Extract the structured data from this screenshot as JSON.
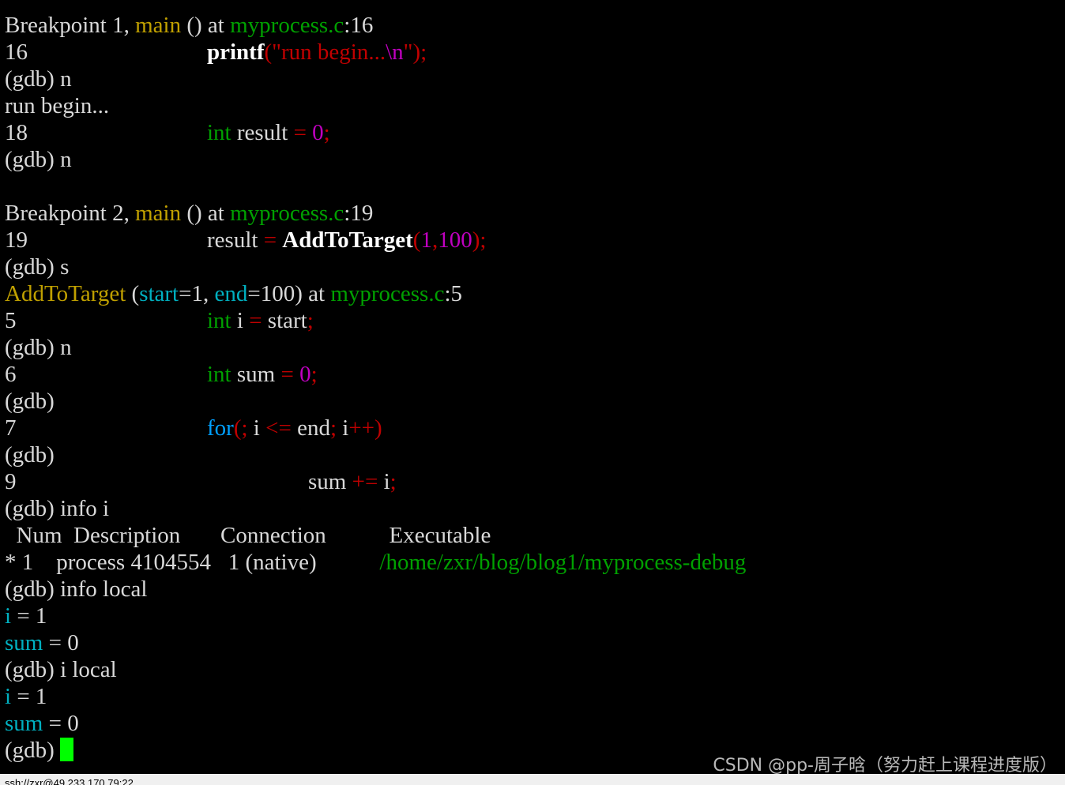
{
  "colors": {
    "background": "#000000",
    "text": "#d9d9d9",
    "function": "#c0a000",
    "filename": "#00a000",
    "string": "#c00000",
    "number": "#c000c0",
    "type": "#00a000",
    "keyword": "#00a0ff",
    "operator": "#c00000",
    "variable": "#00b0c0",
    "cursor": "#00ff00"
  },
  "terminal": {
    "lines": [
      [
        [
          "Breakpoint 1, ",
          "text"
        ],
        [
          "main",
          "function"
        ],
        [
          " () at ",
          "text"
        ],
        [
          "myprocess.c",
          "filename"
        ],
        [
          ":16",
          "text"
        ]
      ],
      [
        [
          "16",
          "text"
        ],
        [
          null,
          "tab1"
        ],
        [
          "printf",
          "bold"
        ],
        [
          "(",
          "operator"
        ],
        [
          "\"run begin...",
          "string"
        ],
        [
          "\\n",
          "number"
        ],
        [
          "\"",
          "string"
        ],
        [
          ");",
          "operator"
        ]
      ],
      [
        [
          "(gdb) n",
          "text"
        ]
      ],
      [
        [
          "run begin...",
          "text"
        ]
      ],
      [
        [
          "18",
          "text"
        ],
        [
          null,
          "tab1"
        ],
        [
          "int",
          "type"
        ],
        [
          " result ",
          "text"
        ],
        [
          "=",
          "operator"
        ],
        [
          " ",
          "text"
        ],
        [
          "0",
          "number"
        ],
        [
          ";",
          "operator"
        ]
      ],
      [
        [
          "(gdb) n",
          "text"
        ]
      ],
      [],
      [
        [
          "Breakpoint 2, ",
          "text"
        ],
        [
          "main",
          "function"
        ],
        [
          " () at ",
          "text"
        ],
        [
          "myprocess.c",
          "filename"
        ],
        [
          ":19",
          "text"
        ]
      ],
      [
        [
          "19",
          "text"
        ],
        [
          null,
          "tab1"
        ],
        [
          "result ",
          "text"
        ],
        [
          "=",
          "operator"
        ],
        [
          " ",
          "text"
        ],
        [
          "AddToTarget",
          "bold"
        ],
        [
          "(",
          "operator"
        ],
        [
          "1",
          "number"
        ],
        [
          ",",
          "operator"
        ],
        [
          "100",
          "number"
        ],
        [
          ");",
          "operator"
        ]
      ],
      [
        [
          "(gdb) s",
          "text"
        ]
      ],
      [
        [
          "AddToTarget",
          "function"
        ],
        [
          " (",
          "text"
        ],
        [
          "start",
          "variable"
        ],
        [
          "=1, ",
          "text"
        ],
        [
          "end",
          "variable"
        ],
        [
          "=100) at ",
          "text"
        ],
        [
          "myprocess.c",
          "filename"
        ],
        [
          ":5",
          "text"
        ]
      ],
      [
        [
          "5",
          "text"
        ],
        [
          null,
          "tab1"
        ],
        [
          "int",
          "type"
        ],
        [
          " i ",
          "text"
        ],
        [
          "=",
          "operator"
        ],
        [
          " start",
          "text"
        ],
        [
          ";",
          "operator"
        ]
      ],
      [
        [
          "(gdb) n",
          "text"
        ]
      ],
      [
        [
          "6",
          "text"
        ],
        [
          null,
          "tab1"
        ],
        [
          "int",
          "type"
        ],
        [
          " sum ",
          "text"
        ],
        [
          "=",
          "operator"
        ],
        [
          " ",
          "text"
        ],
        [
          "0",
          "number"
        ],
        [
          ";",
          "operator"
        ]
      ],
      [
        [
          "(gdb)",
          "text"
        ]
      ],
      [
        [
          "7",
          "text"
        ],
        [
          null,
          "tab1"
        ],
        [
          "for",
          "keyword"
        ],
        [
          "(;",
          "operator"
        ],
        [
          " i ",
          "text"
        ],
        [
          "<=",
          "operator"
        ],
        [
          " end",
          "text"
        ],
        [
          ";",
          "operator"
        ],
        [
          " i",
          "text"
        ],
        [
          "++)",
          "operator"
        ]
      ],
      [
        [
          "(gdb)",
          "text"
        ]
      ],
      [
        [
          "9",
          "text"
        ],
        [
          null,
          "tab2"
        ],
        [
          "sum ",
          "text"
        ],
        [
          "+=",
          "operator"
        ],
        [
          " i",
          "text"
        ],
        [
          ";",
          "operator"
        ]
      ],
      [
        [
          "(gdb) info i",
          "text"
        ]
      ],
      [
        [
          "  Num  Description       Connection           Executable",
          "text"
        ]
      ],
      [
        [
          "* 1    process 4104554   1 (native)           ",
          "text"
        ],
        [
          "/home/zxr/blog/blog1/myprocess-debug",
          "filename"
        ]
      ],
      [
        [
          "(gdb) info local",
          "text"
        ]
      ],
      [
        [
          "i",
          "variable"
        ],
        [
          " = 1",
          "text"
        ]
      ],
      [
        [
          "sum",
          "variable"
        ],
        [
          " = 0",
          "text"
        ]
      ],
      [
        [
          "(gdb) i local",
          "text"
        ]
      ],
      [
        [
          "i",
          "variable"
        ],
        [
          " = 1",
          "text"
        ]
      ],
      [
        [
          "sum",
          "variable"
        ],
        [
          " = 0",
          "text"
        ]
      ],
      [
        [
          "(gdb) ",
          "text"
        ]
      ]
    ]
  },
  "watermark": {
    "text": "CSDN @pp-周子晗（努力赶上课程进度版）"
  },
  "statusbar": {
    "text": "ssh://zxr@49.233.170.79:22"
  }
}
